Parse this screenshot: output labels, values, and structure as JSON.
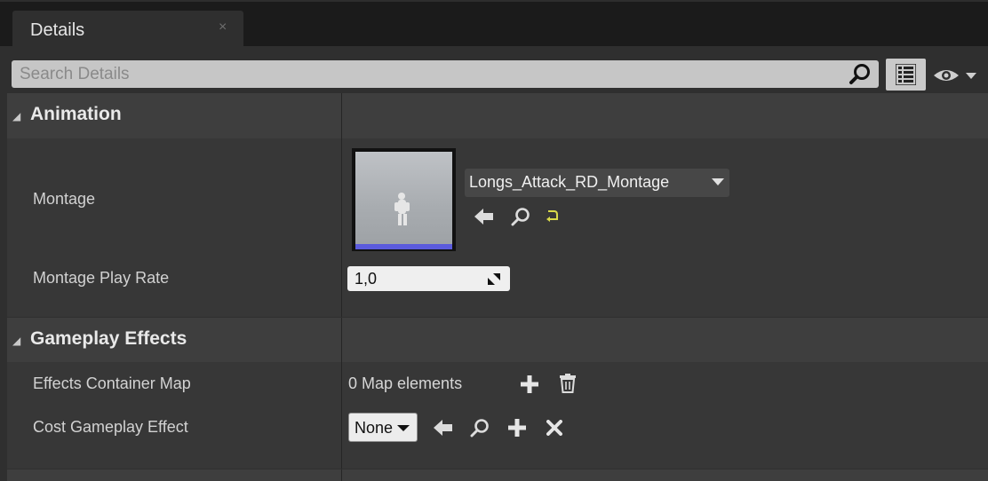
{
  "tab": {
    "title": "Details",
    "close": "×"
  },
  "search": {
    "placeholder": "Search Details"
  },
  "icons": {
    "search": "search-icon",
    "view_options": "list-view-icon",
    "visibility": "eye-icon",
    "browse_prev": "arrow-left-icon",
    "browse": "magnifier-icon",
    "reset": "reset-icon",
    "add": "plus-icon",
    "delete": "trash-icon",
    "clear": "x-icon"
  },
  "sections": {
    "animation": {
      "title": "Animation",
      "montage_label": "Montage",
      "montage_value": "Longs_Attack_RD_Montage",
      "play_rate_label": "Montage Play Rate",
      "play_rate_value": "1,0"
    },
    "gameplay_effects": {
      "title": "Gameplay Effects",
      "effects_map_label": "Effects Container Map",
      "effects_map_value": "0 Map elements",
      "cost_label": "Cost Gameplay Effect",
      "cost_value": "None"
    }
  },
  "colors": {
    "accent_bar": "#5b5bdc",
    "reset_icon": "#d9d94a"
  }
}
